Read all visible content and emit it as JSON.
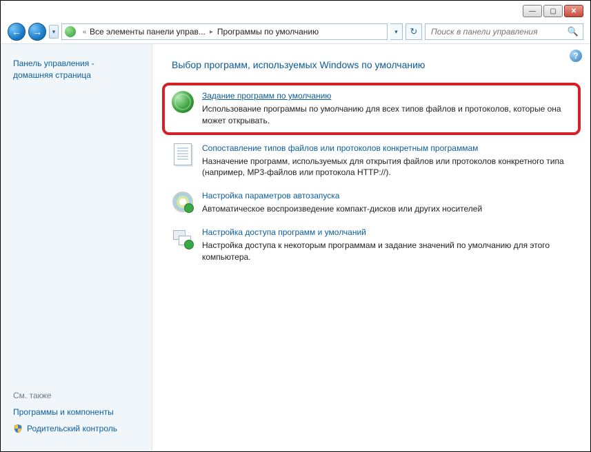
{
  "window_controls": {
    "min": "—",
    "max": "▢",
    "close": "✕"
  },
  "nav": {
    "back": "←",
    "forward": "→",
    "dropdown": "▾",
    "refresh": "↻"
  },
  "breadcrumb": {
    "chevrons": "«",
    "item1": "Все элементы панели управ...",
    "sep": "▸",
    "item2": "Программы по умолчанию",
    "show_dropdown": "▾"
  },
  "search": {
    "placeholder": "Поиск в панели управления",
    "icon": "🔍"
  },
  "sidebar": {
    "title_line1": "Панель управления -",
    "title_line2": "домашняя страница",
    "see_also": "См. также",
    "link_programs": "Программы и компоненты",
    "link_parental": "Родительский контроль"
  },
  "help": "?",
  "main": {
    "title": "Выбор программ, используемых Windows по умолчанию",
    "items": [
      {
        "link": "Задание программ по умолчанию",
        "desc": "Использование программы по умолчанию для всех типов файлов и протоколов, которые она может открывать."
      },
      {
        "link": "Сопоставление типов файлов или протоколов конкретным программам",
        "desc": "Назначение программ, используемых для открытия файлов или протоколов конкретного типа (например, MP3-файлов или протокола HTTP://)."
      },
      {
        "link": "Настройка параметров автозапуска",
        "desc": "Автоматическое воспроизведение компакт-дисков или других носителей"
      },
      {
        "link": "Настройка доступа программ и умолчаний",
        "desc": "Настройка доступа к некоторым программам и задание значений по умолчанию для этого компьютера."
      }
    ]
  }
}
